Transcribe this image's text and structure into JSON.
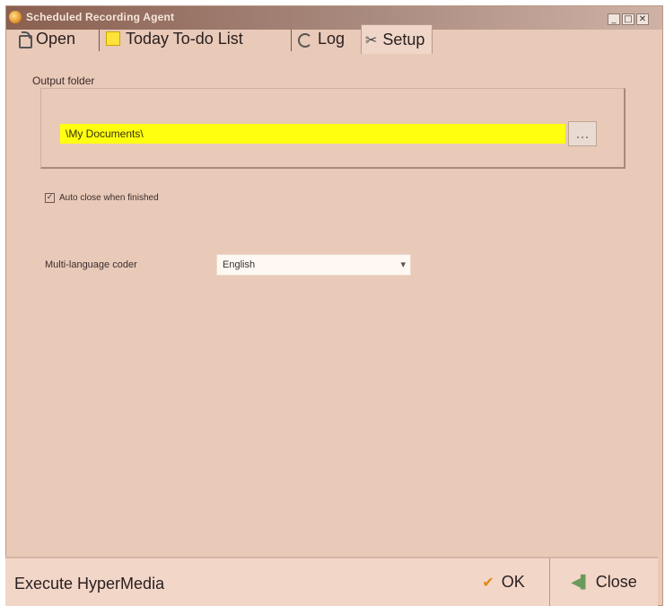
{
  "window": {
    "title": "Scheduled Recording Agent",
    "minimize_glyph": "_",
    "restore_glyph": "□",
    "close_glyph": "✕"
  },
  "tabs": [
    {
      "label": "Open",
      "icon": "open-icon"
    },
    {
      "label": "Today To-do List",
      "icon": "todo-icon"
    },
    {
      "label": "Log",
      "icon": "log-icon"
    },
    {
      "label": "Setup",
      "icon": "setup-icon",
      "active": true
    }
  ],
  "setup": {
    "output_folder_label": "Output folder",
    "output_folder_value": "\\My Documents\\",
    "browse_glyph": "…",
    "auto_close_checked": true,
    "auto_close_label": "Auto close when finished",
    "language_label": "Multi-language coder",
    "language_value": "English",
    "language_arrow": "▾"
  },
  "footer": {
    "status_text": "Execute HyperMedia",
    "ok_label": "OK",
    "close_label": "Close"
  },
  "colors": {
    "background": "#e9c9b8",
    "folder_highlight": "#ffff10",
    "ok_accent": "#e08a10"
  }
}
